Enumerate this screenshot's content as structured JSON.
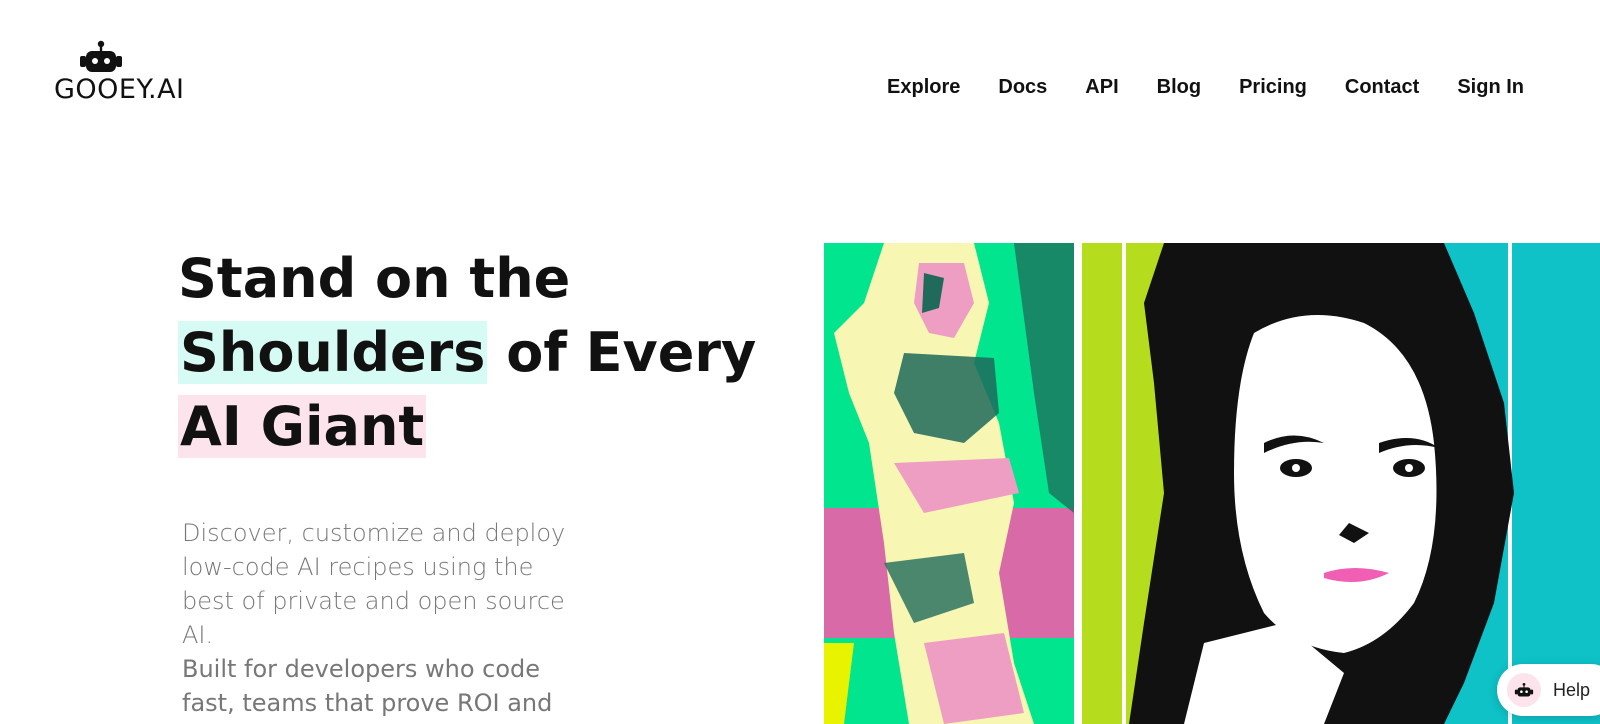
{
  "header": {
    "logo_text": "GOOEY.AI",
    "nav": [
      "Explore",
      "Docs",
      "API",
      "Blog",
      "Pricing",
      "Contact",
      "Sign In"
    ]
  },
  "hero": {
    "title_line1": "Stand on the",
    "title_line2_highlight": "Shoulders",
    "title_line2_rest": " of Every",
    "title_line3_highlight": "AI Giant",
    "description": "Discover, customize and deploy low-code AI recipes using the best of private and open source AI.",
    "description2": "Built for developers who code fast, teams that prove ROI and people"
  },
  "help": {
    "label": "Help",
    "icon": "robot-icon"
  },
  "colors": {
    "highlight_cyan": "#d6fbf4",
    "highlight_pink": "#fde3ec",
    "art_green": "#00e58e",
    "art_lime": "#b5dc1d",
    "art_teal": "#0ec2c8",
    "art_pink": "#e27ab0"
  }
}
